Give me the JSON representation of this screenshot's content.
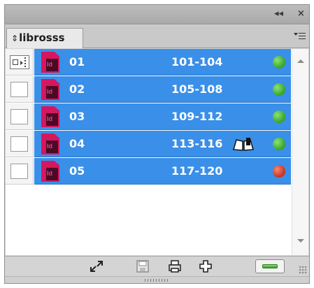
{
  "titlebar": {
    "collapse_icon": "double-left-arrow-icon",
    "close_icon": "close-icon",
    "collapse_glyph": "◂◂",
    "close_glyph": "×"
  },
  "tab": {
    "label": "librosss",
    "arrows_glyph": "⇕"
  },
  "rows": [
    {
      "name": "01",
      "pages": "101-104",
      "status": "green",
      "style_source": true,
      "book_icon": false
    },
    {
      "name": "02",
      "pages": "105-108",
      "status": "green",
      "style_source": false,
      "book_icon": false
    },
    {
      "name": "03",
      "pages": "109-112",
      "status": "green",
      "style_source": false,
      "book_icon": false
    },
    {
      "name": "04",
      "pages": "113-116",
      "status": "green",
      "style_source": false,
      "book_icon": true
    },
    {
      "name": "05",
      "pages": "117-120",
      "status": "red",
      "style_source": false,
      "book_icon": false
    }
  ],
  "colors": {
    "selection": "#3a8fe8",
    "status_green": "#3fae2c",
    "status_red": "#d23a26",
    "indesign": "#d4175f"
  },
  "bottom_icons": [
    "synchronize-icon",
    "save-book-icon",
    "print-book-icon",
    "add-document-icon",
    "remove-document-icon"
  ]
}
